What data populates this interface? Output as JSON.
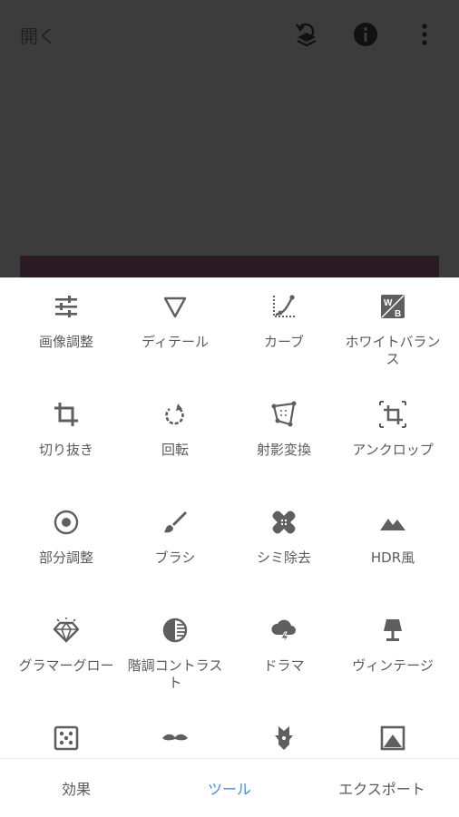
{
  "header": {
    "open_label": "開く"
  },
  "tools": [
    {
      "label": "画像調整",
      "icon": "tune-icon"
    },
    {
      "label": "ディテール",
      "icon": "triangle-down-icon"
    },
    {
      "label": "カーブ",
      "icon": "curves-icon"
    },
    {
      "label": "ホワイトバランス",
      "icon": "white-balance-icon"
    },
    {
      "label": "切り抜き",
      "icon": "crop-icon"
    },
    {
      "label": "回転",
      "icon": "rotate-icon"
    },
    {
      "label": "射影変換",
      "icon": "perspective-icon"
    },
    {
      "label": "アンクロップ",
      "icon": "expand-icon"
    },
    {
      "label": "部分調整",
      "icon": "selective-icon"
    },
    {
      "label": "ブラシ",
      "icon": "brush-icon"
    },
    {
      "label": "シミ除去",
      "icon": "healing-icon"
    },
    {
      "label": "HDR風",
      "icon": "mountains-icon"
    },
    {
      "label": "グラマーグロー",
      "icon": "diamond-icon"
    },
    {
      "label": "階調コントラスト",
      "icon": "tonal-contrast-icon"
    },
    {
      "label": "ドラマ",
      "icon": "cloud-lightning-icon"
    },
    {
      "label": "ヴィンテージ",
      "icon": "lamp-icon"
    },
    {
      "label": "",
      "icon": "dice-icon"
    },
    {
      "label": "",
      "icon": "mustache-icon"
    },
    {
      "label": "",
      "icon": "guitar-icon"
    },
    {
      "label": "",
      "icon": "frame-icon"
    }
  ],
  "bottom_nav": {
    "looks": "効果",
    "tools": "ツール",
    "export": "エクスポート"
  },
  "colors": {
    "accent": "#3d8df5",
    "icon": "#5f5f5f",
    "overlay": "#3c3c3c"
  }
}
